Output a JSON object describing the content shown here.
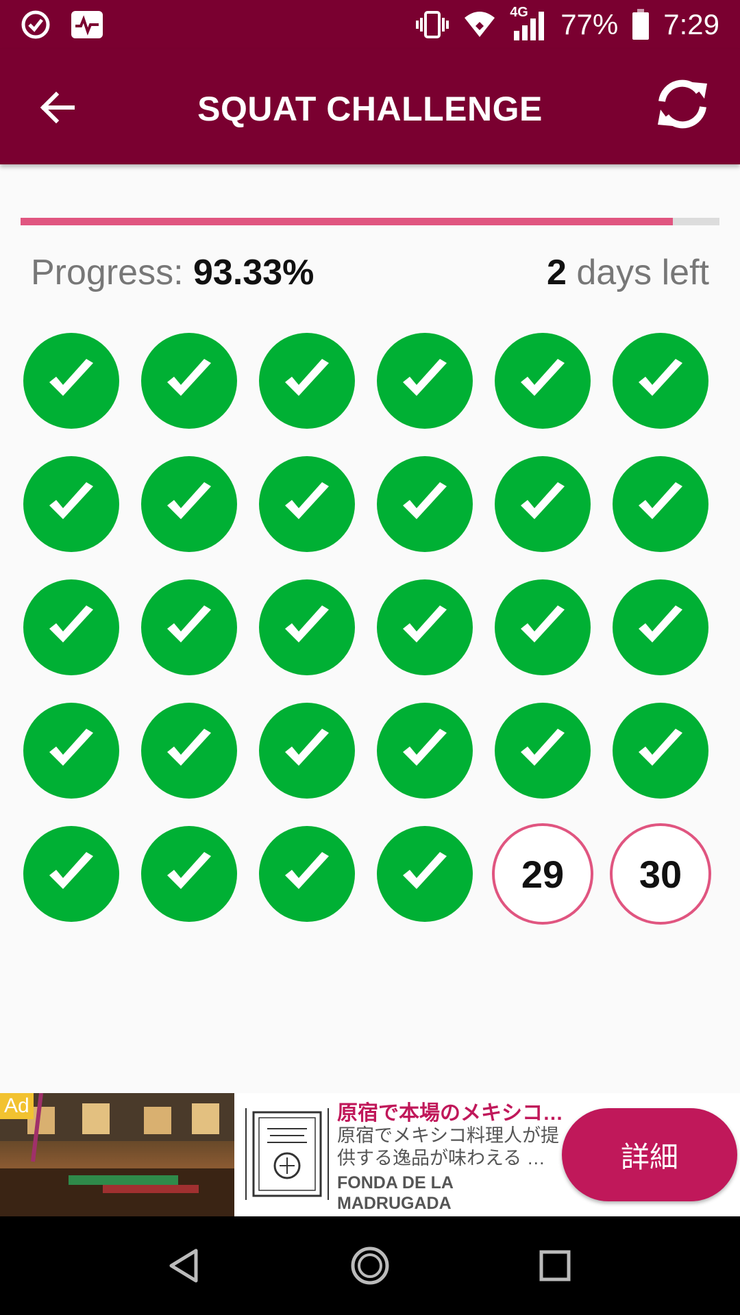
{
  "status_bar": {
    "battery": "77%",
    "time": "7:29",
    "network": "4G"
  },
  "app_bar": {
    "title": "SQUAT CHALLENGE"
  },
  "progress": {
    "label": "Progress:",
    "value_text": "93.33%",
    "fraction": 0.9333,
    "days_left_number": "2",
    "days_left_suffix": "days left"
  },
  "days": [
    {
      "day": 1,
      "done": true
    },
    {
      "day": 2,
      "done": true
    },
    {
      "day": 3,
      "done": true
    },
    {
      "day": 4,
      "done": true
    },
    {
      "day": 5,
      "done": true
    },
    {
      "day": 6,
      "done": true
    },
    {
      "day": 7,
      "done": true
    },
    {
      "day": 8,
      "done": true
    },
    {
      "day": 9,
      "done": true
    },
    {
      "day": 10,
      "done": true
    },
    {
      "day": 11,
      "done": true
    },
    {
      "day": 12,
      "done": true
    },
    {
      "day": 13,
      "done": true
    },
    {
      "day": 14,
      "done": true
    },
    {
      "day": 15,
      "done": true
    },
    {
      "day": 16,
      "done": true
    },
    {
      "day": 17,
      "done": true
    },
    {
      "day": 18,
      "done": true
    },
    {
      "day": 19,
      "done": true
    },
    {
      "day": 20,
      "done": true
    },
    {
      "day": 21,
      "done": true
    },
    {
      "day": 22,
      "done": true
    },
    {
      "day": 23,
      "done": true
    },
    {
      "day": 24,
      "done": true
    },
    {
      "day": 25,
      "done": true
    },
    {
      "day": 26,
      "done": true
    },
    {
      "day": 27,
      "done": true
    },
    {
      "day": 28,
      "done": true
    },
    {
      "day": 29,
      "done": false
    },
    {
      "day": 30,
      "done": false
    }
  ],
  "ad": {
    "badge": "Ad",
    "title": "原宿で本場のメキシコ…",
    "description": "原宿でメキシコ料理人が提供する逸品が味わえる …",
    "brand": "FONDA DE LA MADRUGADA",
    "cta": "詳細"
  },
  "colors": {
    "primary": "#7a0030",
    "accent": "#e05580",
    "done": "#00b034",
    "ad_accent": "#c0185a"
  },
  "icons": {
    "back": "arrow-left-icon",
    "refresh": "refresh-icon",
    "done": "check-icon"
  }
}
